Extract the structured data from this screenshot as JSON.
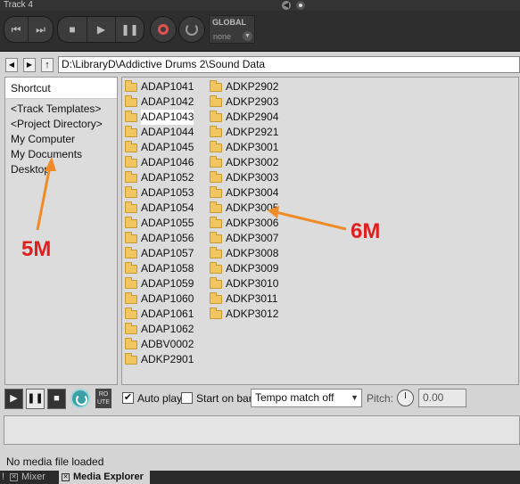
{
  "window": {
    "title": "Track 4"
  },
  "transport": {
    "global_label": "GLOBAL",
    "global_value": "none"
  },
  "path": {
    "value": "D:\\LibraryD\\Addictive Drums 2\\Sound Data"
  },
  "shortcuts": {
    "header": "Shortcut",
    "items": [
      "<Track Templates>",
      "<Project Directory>",
      "My Computer",
      "My Documents",
      "Desktop"
    ]
  },
  "files": {
    "column1": [
      "ADAP1041",
      "ADAP1042",
      "ADAP1043",
      "ADAP1044",
      "ADAP1045",
      "ADAP1046",
      "ADAP1052",
      "ADAP1053",
      "ADAP1054",
      "ADAP1055",
      "ADAP1056",
      "ADAP1057",
      "ADAP1058",
      "ADAP1059",
      "ADAP1060",
      "ADAP1061",
      "ADAP1062",
      "ADBV0002",
      "ADKP2901"
    ],
    "column2": [
      "ADKP2902",
      "ADKP2903",
      "ADKP2904",
      "ADKP2921",
      "ADKP3001",
      "ADKP3002",
      "ADKP3003",
      "ADKP3004",
      "ADKP3005",
      "ADKP3006",
      "ADKP3007",
      "ADKP3008",
      "ADKP3009",
      "ADKP3010",
      "ADKP3011",
      "ADKP3012"
    ]
  },
  "controls": {
    "route_label": "RO UTE",
    "auto_play_label": "Auto play",
    "auto_play_checked": true,
    "start_on_bar_label": "Start on bar",
    "start_on_bar_checked": false,
    "tempo_match_value": "Tempo match off",
    "pitch_label": "Pitch:",
    "pitch_value": "0.00"
  },
  "status": {
    "text": "No media file loaded"
  },
  "tabs": [
    {
      "label": "Mixer",
      "active": false
    },
    {
      "label": "Media Explorer",
      "active": true
    }
  ],
  "annotations": {
    "left": "5M",
    "right": "6M",
    "color": "#e02020",
    "arrow_color": "#f08c28"
  }
}
